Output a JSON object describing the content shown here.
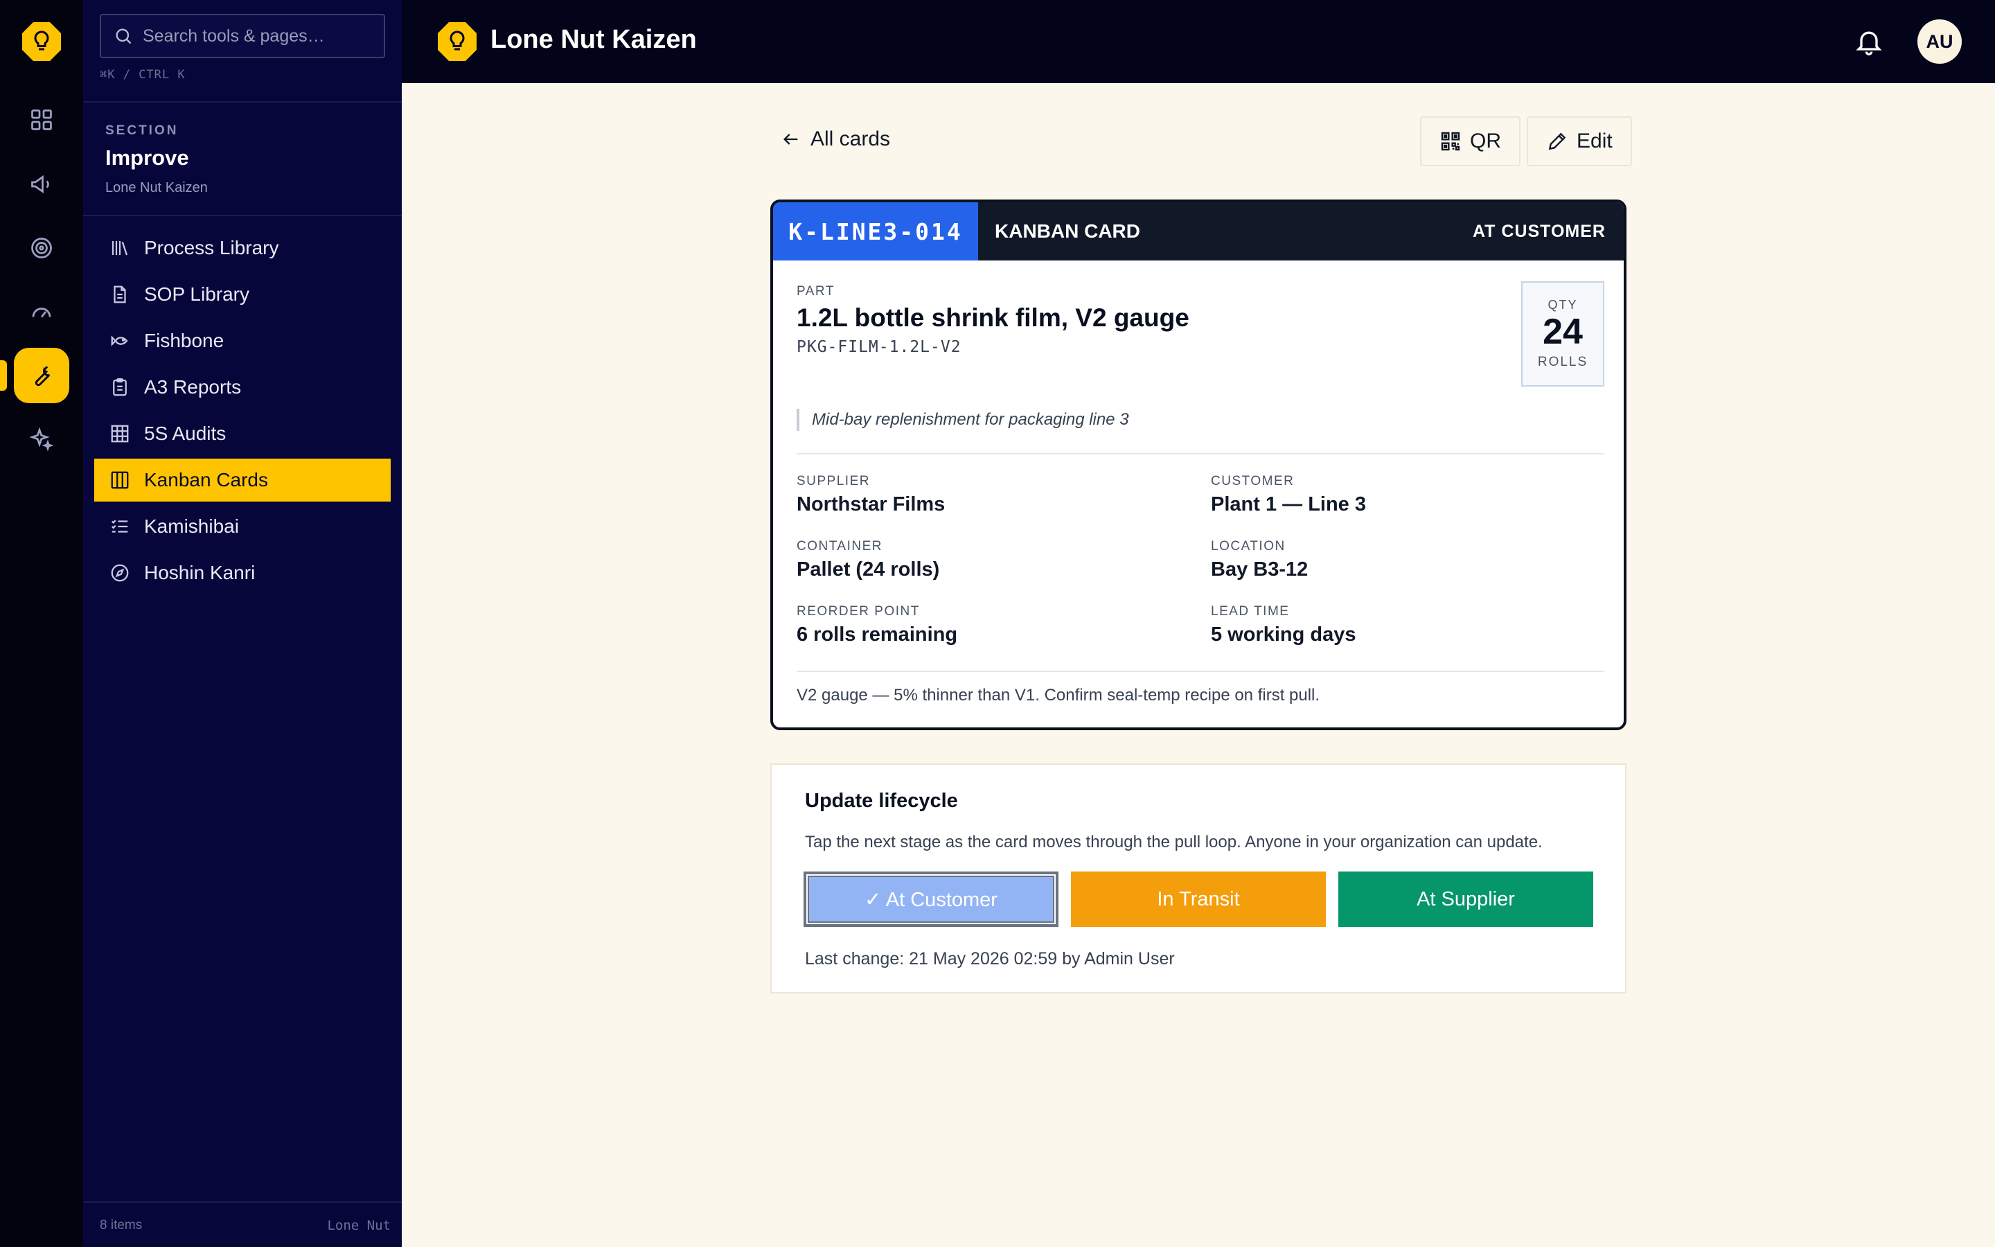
{
  "app": {
    "name": "Lone Nut Kaizen",
    "user_initials": "AU"
  },
  "colors": {
    "accent": "#ffc400",
    "rail_bg": "#03030f",
    "sidebar_bg": "#07063a",
    "card_id_blue": "#2563eb",
    "in_transit": "#f59e0b",
    "at_supplier": "#059669",
    "at_customer_current": "#93b4f4"
  },
  "rail": {
    "items": [
      {
        "name": "dashboard-grid-icon"
      },
      {
        "name": "megaphone-icon"
      },
      {
        "name": "target-icon"
      },
      {
        "name": "gauge-icon"
      },
      {
        "name": "wrench-icon",
        "active": true
      },
      {
        "name": "sparkles-icon"
      }
    ]
  },
  "sidebar": {
    "search": {
      "placeholder": "Search tools & pages…",
      "value": ""
    },
    "shortcut": "⌘K / CTRL K",
    "section_label": "SECTION",
    "section_title": "Improve",
    "section_org": "Lone Nut Kaizen",
    "items": [
      {
        "label": "Process Library",
        "icon": "library-icon"
      },
      {
        "label": "SOP Library",
        "icon": "document-icon"
      },
      {
        "label": "Fishbone",
        "icon": "fish-icon"
      },
      {
        "label": "A3 Reports",
        "icon": "clipboard-icon"
      },
      {
        "label": "5S Audits",
        "icon": "grid-icon"
      },
      {
        "label": "Kanban Cards",
        "icon": "columns-icon",
        "active": true
      },
      {
        "label": "Kamishibai",
        "icon": "checklist-icon"
      },
      {
        "label": "Hoshin Kanri",
        "icon": "compass-icon"
      }
    ],
    "footer_count": "8 items",
    "footer_brand": "Lone Nut"
  },
  "main": {
    "back_label": "All cards",
    "qr_label": "QR",
    "edit_label": "Edit"
  },
  "card": {
    "id": "K-LINE3-014",
    "type": "KANBAN CARD",
    "status": "AT CUSTOMER",
    "part_label": "PART",
    "part_name": "1.2L bottle shrink film, V2 gauge",
    "part_code": "PKG-FILM-1.2L-V2",
    "qty_label": "QTY",
    "qty": "24",
    "qty_unit": "ROLLS",
    "note": "Mid-bay replenishment for packaging line 3",
    "fields": {
      "supplier": {
        "label": "SUPPLIER",
        "value": "Northstar Films"
      },
      "customer": {
        "label": "CUSTOMER",
        "value": "Plant 1 — Line 3"
      },
      "container": {
        "label": "CONTAINER",
        "value": "Pallet (24 rolls)"
      },
      "location": {
        "label": "LOCATION",
        "value": "Bay B3-12"
      },
      "reorder": {
        "label": "REORDER POINT",
        "value": "6 rolls remaining"
      },
      "lead_time": {
        "label": "LEAD TIME",
        "value": "5 working days"
      }
    },
    "footnote": "V2 gauge — 5% thinner than V1. Confirm seal-temp recipe on first pull."
  },
  "lifecycle": {
    "title": "Update lifecycle",
    "description": "Tap the next stage as the card moves through the pull loop. Anyone in your organization can update.",
    "stages": [
      {
        "label": "✓ At Customer",
        "current": true
      },
      {
        "label": "In Transit"
      },
      {
        "label": "At Supplier"
      }
    ],
    "last_change": "Last change: 21 May 2026 02:59 by Admin User"
  }
}
